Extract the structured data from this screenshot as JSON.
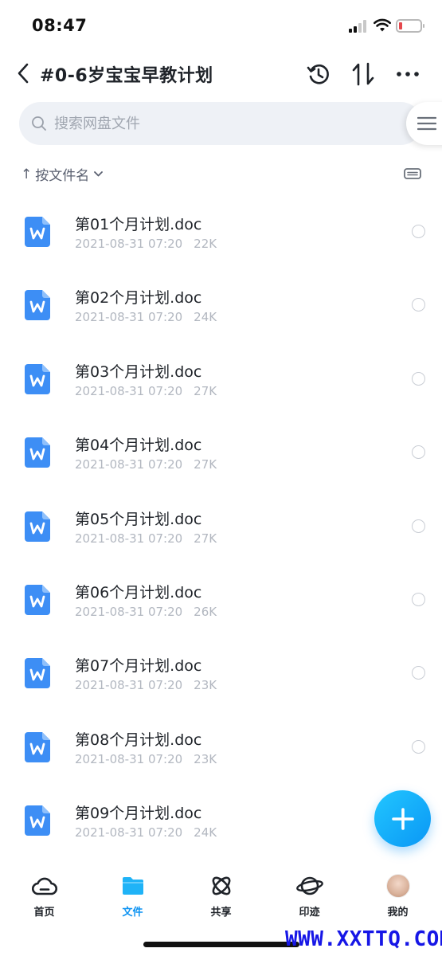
{
  "status_bar": {
    "time": "08:47"
  },
  "nav": {
    "title": "#0-6岁宝宝早教计划",
    "actions": [
      "history-icon",
      "sort-icon",
      "more-icon"
    ]
  },
  "search": {
    "placeholder": "搜索网盘文件",
    "value": ""
  },
  "sort": {
    "arrow": "↑",
    "label": "按文件名"
  },
  "files": [
    {
      "name": "第01个月计划.doc",
      "date": "2021-08-31 07:20",
      "size": "22K"
    },
    {
      "name": "第02个月计划.doc",
      "date": "2021-08-31 07:20",
      "size": "24K"
    },
    {
      "name": "第03个月计划.doc",
      "date": "2021-08-31 07:20",
      "size": "27K"
    },
    {
      "name": "第04个月计划.doc",
      "date": "2021-08-31 07:20",
      "size": "27K"
    },
    {
      "name": "第05个月计划.doc",
      "date": "2021-08-31 07:20",
      "size": "27K"
    },
    {
      "name": "第06个月计划.doc",
      "date": "2021-08-31 07:20",
      "size": "26K"
    },
    {
      "name": "第07个月计划.doc",
      "date": "2021-08-31 07:20",
      "size": "23K"
    },
    {
      "name": "第08个月计划.doc",
      "date": "2021-08-31 07:20",
      "size": "23K"
    },
    {
      "name": "第09个月计划.doc",
      "date": "2021-08-31 07:20",
      "size": "24K"
    }
  ],
  "tabs": [
    {
      "label": "首页",
      "icon": "cloud-icon",
      "active": false
    },
    {
      "label": "文件",
      "icon": "folder-icon",
      "active": true
    },
    {
      "label": "共享",
      "icon": "atom-icon",
      "active": false
    },
    {
      "label": "印迹",
      "icon": "planet-icon",
      "active": false
    },
    {
      "label": "我的",
      "icon": "avatar",
      "active": false
    }
  ],
  "colors": {
    "accent": "#0d93f2",
    "fab": "#12b0fb",
    "doc_icon": "#3d8ef5",
    "watermark": "#1616e6"
  },
  "watermark": "WWW.XXTTQ.COM"
}
